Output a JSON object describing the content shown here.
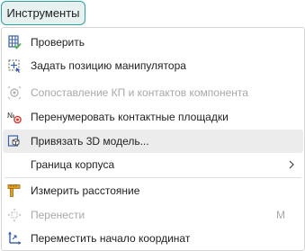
{
  "menubar": {
    "title": "Инструменты"
  },
  "menu": {
    "items": [
      {
        "label": "Проверить",
        "icon": "grid-check-icon",
        "enabled": true
      },
      {
        "label": "Задать позицию манипулятора",
        "icon": "manipulator-position-icon",
        "enabled": true
      },
      {
        "label": "Сопоставление КП и контактов компонента",
        "icon": "pad-contact-match-icon",
        "enabled": false
      },
      {
        "label": "Перенумеровать контактные площадки",
        "icon": "renumber-pads-icon",
        "enabled": true
      },
      {
        "label": "Привязать 3D модель...",
        "icon": "bind-3d-model-icon",
        "enabled": true,
        "hovered": true
      },
      {
        "label": "Граница корпуса",
        "icon": "",
        "enabled": true,
        "submenu": true
      },
      {
        "label": "Измерить расстояние",
        "icon": "measure-distance-icon",
        "enabled": true
      },
      {
        "label": "Перенести",
        "icon": "move-icon",
        "enabled": false,
        "shortcut": "M"
      },
      {
        "label": "Переместить начало координат",
        "icon": "move-origin-icon",
        "enabled": true
      }
    ]
  },
  "colors": {
    "accent": "#2aa4a0",
    "menubar_active_bg": "#e6f1f0",
    "hover_bg": "#ececec",
    "disabled_text": "#a8a8a8",
    "icon_blue": "#3a5fa8",
    "icon_green": "#4cae4f",
    "icon_red": "#d9342b",
    "icon_orange": "#e8a020"
  }
}
